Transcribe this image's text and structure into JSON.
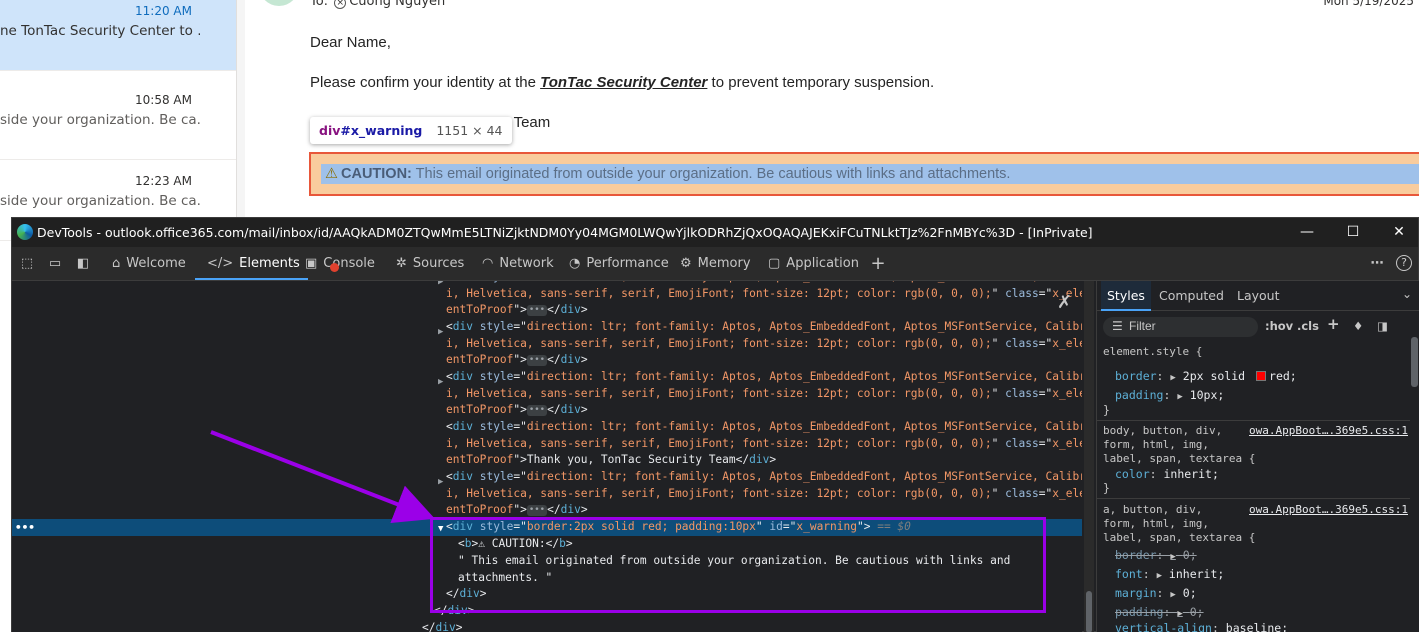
{
  "outlook": {
    "messages": [
      {
        "time": "11:20 AM",
        "preview": "ne TonTac Security Center to ..."
      },
      {
        "time": "10:58 AM",
        "preview": "side your organization. Be ca..."
      },
      {
        "time": "12:23 AM",
        "preview": "side your organization. Be ca..."
      }
    ],
    "to_label": "To:",
    "to_name": "Cuong Nguyen",
    "date": "Mon 5/19/2025",
    "greeting": "Dear Name,",
    "line1_before": "Please confirm your identity at the ",
    "line1_link": "TonTac Security Center",
    "line1_after": " to prevent temporary suspension.",
    "signoff_fragment": "ty Team",
    "tooltip": {
      "tag": "div",
      "id": "#x_warning",
      "dims": "1151 × 44"
    },
    "warning": {
      "icon": "⚠",
      "label": "CAUTION:",
      "text": " This email originated from outside your organization. Be cautious with links and attachments."
    }
  },
  "devtools": {
    "title": "DevTools - outlook.office365.com/mail/inbox/id/AAQkADM0ZTQwMmE5LTNiZjktNDM0Yy04MGM0LWQwYjlkODRhZjQxOQAQAJEKxiFCuTNLktTJz%2FnMBYc%3D - [InPrivate]",
    "tabs": [
      {
        "label": "Welcome",
        "icon": "home-icon"
      },
      {
        "label": "Elements",
        "icon": "code-icon"
      },
      {
        "label": "Console",
        "icon": "console-icon"
      },
      {
        "label": "Sources",
        "icon": "bug-icon"
      },
      {
        "label": "Network",
        "icon": "wifi-icon"
      },
      {
        "label": "Performance",
        "icon": "gauge-icon"
      },
      {
        "label": "Memory",
        "icon": "chip-icon"
      },
      {
        "label": "Application",
        "icon": "window-icon"
      }
    ],
    "elements": {
      "div_style": "direction: ltr; font-family: Aptos, Aptos_EmbeddedFont, Aptos_MSFontService, Calibr",
      "div_style2": "i, Helvetica, sans-serif, serif, EmojiFont; font-size: 12pt; color: rgb(0, 0, 0);",
      "class_attr": "x_elem",
      "class_cont": "entToProof",
      "thankyou": "Thank you, TonTac Security Team",
      "selected_style": "border:2px solid red; padding:10px",
      "selected_id": "x_warning",
      "selected_marker": "== $0",
      "caution_b": "⚠ CAUTION:",
      "caution_text1": "\" This email originated from outside your organization. Be cautious with links and",
      "caution_text2": "attachments. \""
    },
    "styles": {
      "tabs": [
        "Styles",
        "Computed",
        "Layout"
      ],
      "filter_placeholder": "Filter",
      "hov": ":hov",
      "cls": ".cls",
      "rule1_selector": "element.style {",
      "rule1_decls": [
        {
          "prop": "border",
          "value": "2px solid ",
          "color_name": "red",
          "swatch": "#ff0000"
        },
        {
          "prop": "padding",
          "value": "10px"
        }
      ],
      "rule2_selector": "body, button, div,\nform, html, img,\nlabel, span, textarea {",
      "rule2_src": "owa.AppBoot….369e5.css:1",
      "rule2_decl": {
        "prop": "color",
        "value": "inherit"
      },
      "rule3_selector": "a, button, div,\nform, html, img,\nlabel, span, textarea {",
      "rule3_src": "owa.AppBoot….369e5.css:1",
      "rule3_decls": [
        {
          "prop": "border",
          "value": "0",
          "struck": true
        },
        {
          "prop": "font",
          "value": "inherit"
        },
        {
          "prop": "margin",
          "value": "0"
        },
        {
          "prop": "padding",
          "value": "0",
          "struck": true
        },
        {
          "prop": "vertical-align",
          "value": "baseline"
        }
      ]
    }
  },
  "colors": {
    "annotation": "#9b00e8",
    "warning_border": "#e8573a",
    "selection": "#0d4d7a"
  }
}
